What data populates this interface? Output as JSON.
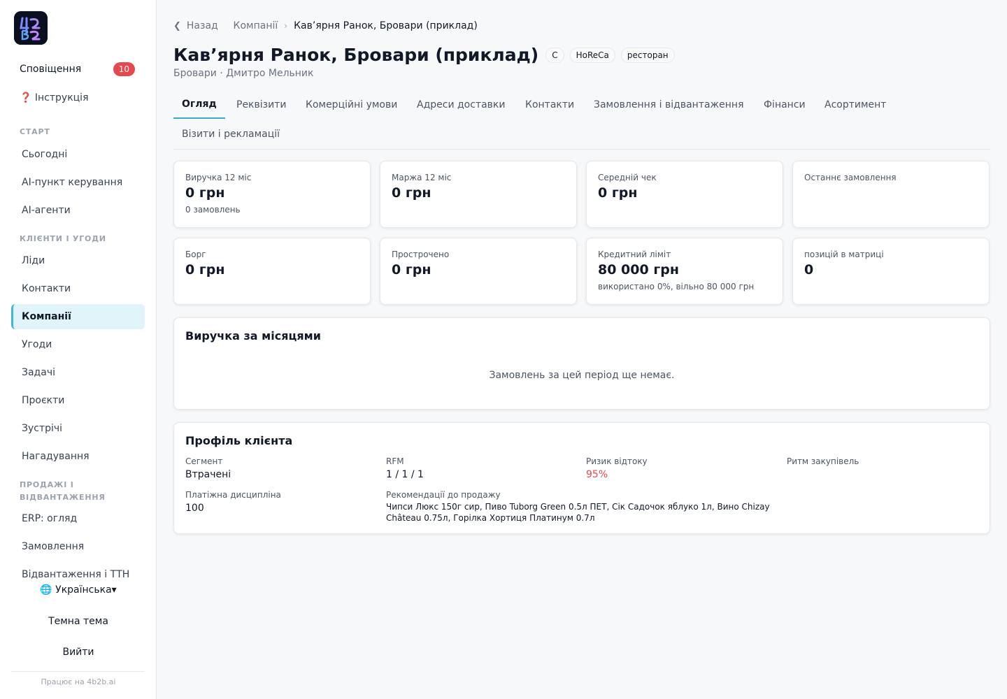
{
  "sidebar": {
    "notifications_label": "Сповіщення",
    "notifications_count": "10",
    "help_label": "❓ Інструкція",
    "sections": {
      "start": "СТАРТ",
      "clients": "КЛІЄНТИ І УГОДИ",
      "sales": "ПРОДАЖІ І ВІДВАНТАЖЕННЯ"
    },
    "items": {
      "today": "Сьогодні",
      "ai_control": "AI-пункт керування",
      "ai_agents": "AI-агенти",
      "leads": "Ліди",
      "contacts": "Контакти",
      "companies": "Компанії",
      "deals": "Угоди",
      "tasks": "Задачі",
      "projects": "Проєкти",
      "meetings": "Зустрічі",
      "reminders": "Нагадування",
      "erp": "ERP: огляд",
      "orders": "Замовлення",
      "shipments": "Відвантаження і ТТН"
    },
    "language": "🌐 Українська▾",
    "dark_theme": "Темна тема",
    "logout": "Вийти",
    "powered_by": "Працює на 4b2b.ai"
  },
  "breadcrumb": {
    "back": "Назад",
    "companies": "Компанії",
    "current": "Кав’ярня Ранок, Бровари (приклад)"
  },
  "header": {
    "title": "Кав’ярня Ранок, Бровари (приклад)",
    "chips": [
      "C",
      "HoReCa",
      "ресторан"
    ],
    "subtitle": "Бровари · Дмитро Мельник"
  },
  "tabs": [
    "Огляд",
    "Реквізити",
    "Комерційні умови",
    "Адреси доставки",
    "Контакти",
    "Замовлення і відвантаження",
    "Фінанси",
    "Асортимент",
    "Візити і рекламації"
  ],
  "kpis": [
    {
      "label": "Виручка 12 міс",
      "value": "0 грн",
      "sub": "0 замовлень"
    },
    {
      "label": "Маржа 12 міс",
      "value": "0 грн",
      "sub": ""
    },
    {
      "label": "Середній чек",
      "value": "0 грн",
      "sub": ""
    },
    {
      "label": "Останнє замовлення",
      "value": "",
      "sub": ""
    },
    {
      "label": "Борг",
      "value": "0 грн",
      "sub": ""
    },
    {
      "label": "Прострочено",
      "value": "0 грн",
      "sub": ""
    },
    {
      "label": "Кредитний ліміт",
      "value": "80 000 грн",
      "sub": "використано 0%, вільно 80 000 грн"
    },
    {
      "label": "позицій в матриці",
      "value": "0",
      "sub": ""
    }
  ],
  "revenue": {
    "title": "Виручка за місяцями",
    "empty": "Замовлень за цей період ще немає."
  },
  "profile": {
    "title": "Профіль клієнта",
    "segment_label": "Сегмент",
    "segment_value": "Втрачені",
    "rfm_label": "RFM",
    "rfm_value": "1 / 1 / 1",
    "churn_label": "Ризик відтоку",
    "churn_value": "95%",
    "rhythm_label": "Ритм закупівель",
    "discipline_label": "Платіжна дисципліна",
    "discipline_value": "100",
    "reco_label": "Рекомендації до продажу",
    "reco_value": "Чипси Люкс 150г сир, Пиво Tuborg Green 0.5л ПЕТ, Сік Садочок яблуко 1л, Вино Chizay Château 0.75л, Горілка Хортиця Платинум 0.7л"
  },
  "colors": {
    "accent": "#3aa6cc",
    "active_bg": "#e0f4fa",
    "badge": "#e5484d",
    "risk": "#e5484d"
  }
}
